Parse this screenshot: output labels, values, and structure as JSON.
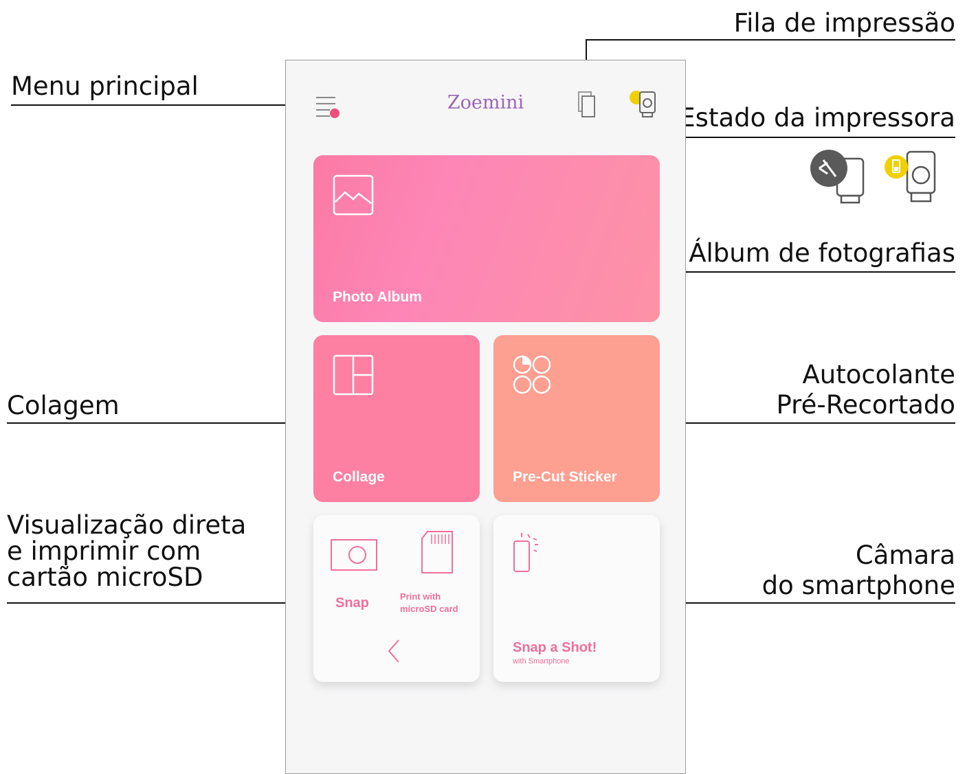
{
  "callouts": {
    "queue": "Fila de impressão",
    "main_menu": "Menu principal",
    "printer_status": "Estado da impressora",
    "photo_album": "Álbum de fotografias",
    "sticker_line1": "Autocolante",
    "sticker_line2": "Pré-Recortado",
    "collage": "Colagem",
    "preview_line1": "Visualização direta",
    "preview_line2": "e imprimir com",
    "preview_line3": "cartão microSD",
    "camera_line1": "Câmara",
    "camera_line2": "do smartphone"
  },
  "app": {
    "title": "Zoemini",
    "tiles": {
      "photo_album": "Photo Album",
      "collage": "Collage",
      "sticker": "Pre-Cut Sticker",
      "snap": "Snap",
      "print_sd_line1": "Print with",
      "print_sd_line2": "microSD card",
      "snap_shot": "Snap a Shot!",
      "snap_shot_sub": "with Smartphone"
    }
  },
  "colors": {
    "accent_pink": "#ef6f98",
    "battery_yellow": "#f0d000",
    "disconnected_gray": "#5a5a5a"
  },
  "icons": [
    "menu-icon",
    "print-queue-icon",
    "printer-status-icon",
    "printer-disconnected-icon",
    "printer-battery-icon",
    "image-icon",
    "collage-grid-icon",
    "sticker-circles-icon",
    "camera-icon",
    "sd-card-icon",
    "back-chevron-icon",
    "phone-camera-icon"
  ]
}
